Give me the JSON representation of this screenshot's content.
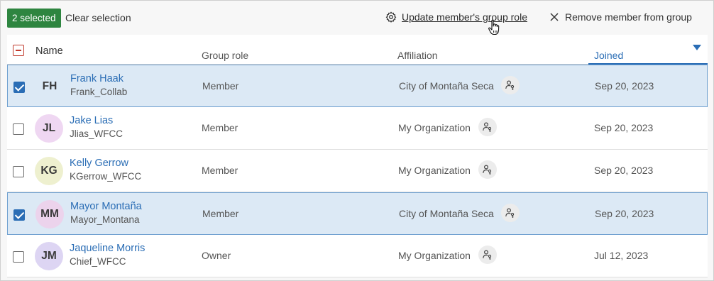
{
  "toolbar": {
    "selected_badge": "2 selected",
    "clear_selection": "Clear selection",
    "update_role": "Update member's group role",
    "remove_member": "Remove member from group"
  },
  "table": {
    "headers": {
      "name": "Name",
      "role": "Group role",
      "affiliation": "Affiliation",
      "joined": "Joined"
    },
    "rows": [
      {
        "initials": "FH",
        "name": "Frank Haak",
        "username": "Frank_Collab",
        "role": "Member",
        "affiliation": "City of Montaña Seca",
        "joined": "Sep 20, 2023",
        "selected": true,
        "avatar_color": "#dce9f5"
      },
      {
        "initials": "JL",
        "name": "Jake Lias",
        "username": "Jlias_WFCC",
        "role": "Member",
        "affiliation": "My Organization",
        "joined": "Sep 20, 2023",
        "selected": false,
        "avatar_color": "#efd7f2"
      },
      {
        "initials": "KG",
        "name": "Kelly Gerrow",
        "username": "KGerrow_WFCC",
        "role": "Member",
        "affiliation": "My Organization",
        "joined": "Sep 20, 2023",
        "selected": false,
        "avatar_color": "#eef0cf"
      },
      {
        "initials": "MM",
        "name": "Mayor Montaña",
        "username": "Mayor_Montana",
        "role": "Member",
        "affiliation": "City of Montaña Seca",
        "joined": "Sep 20, 2023",
        "selected": true,
        "avatar_color": "#ecd3ec"
      },
      {
        "initials": "JM",
        "name": "Jaqueline Morris",
        "username": "Chief_WFCC",
        "role": "Owner",
        "affiliation": "My Organization",
        "joined": "Jul 12, 2023",
        "selected": false,
        "avatar_color": "#ddd5f3"
      }
    ]
  },
  "colors": {
    "accent": "#2a6db5",
    "badge": "#2e8540",
    "selected_row": "#dce9f5"
  },
  "icons": {
    "update": "gear-icon",
    "remove": "close-icon",
    "affiliation": "user-key-icon",
    "sort": "caret-down-icon"
  }
}
